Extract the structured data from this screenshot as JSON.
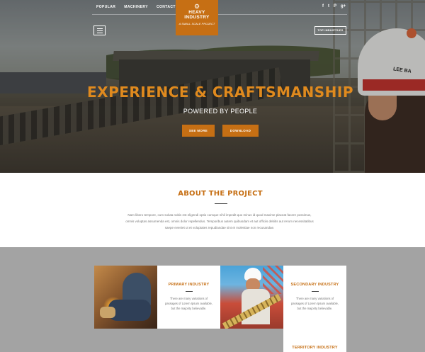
{
  "nav": {
    "links": [
      "POPULAR",
      "MACHINERY",
      "CONTACT"
    ]
  },
  "logo": {
    "icon": "gear-icon",
    "name_line1": "HEAVY",
    "name_line2": "INDUSTRY",
    "tagline": "A SMALL SCALE PROJECT"
  },
  "social": {
    "facebook": "f",
    "twitter": "t",
    "pinterest": "P",
    "google": "g+"
  },
  "hero": {
    "top_industries_label": "TOP INDUSTRIES",
    "helmet_text": "LEE BA",
    "title": "EXPERIENCE & CRAFTSMANSHIP",
    "subtitle": "POWERED BY PEOPLE",
    "see_more_label": "SEE MORE",
    "download_label": "DOWNLOAD"
  },
  "about": {
    "heading": "ABOUT THE PROJECT",
    "body": "Nam libero tempore, cum soluta nobis est eligendi optio cumque nihil impedit quo minus id quod maxime placeat facere possimus, omnis voluptas assumenda est, omnis dolor repellendus. Temporibus autem quibusdam et aut officiis debitis aut rerum necessitatibus saepe eveniet ut et voluptates repudiandae sint et molestiae non recusandae."
  },
  "industries": {
    "cards": [
      {
        "title": "PRIMARY INDUSTRY",
        "text": "There are many variations of passages of Lorem Ipsum available, but the majority believable."
      },
      {
        "title": "SECONDARY INDUSTRY",
        "text": "There are many variations of passages of Lorem Ipsum available, but the majority believable."
      },
      {
        "title": "TERRITORY INDUSTRY",
        "text": ""
      }
    ]
  },
  "colors": {
    "accent": "#c66f14",
    "title_orange": "#e08a1e",
    "section_grey": "#a3a3a3"
  }
}
